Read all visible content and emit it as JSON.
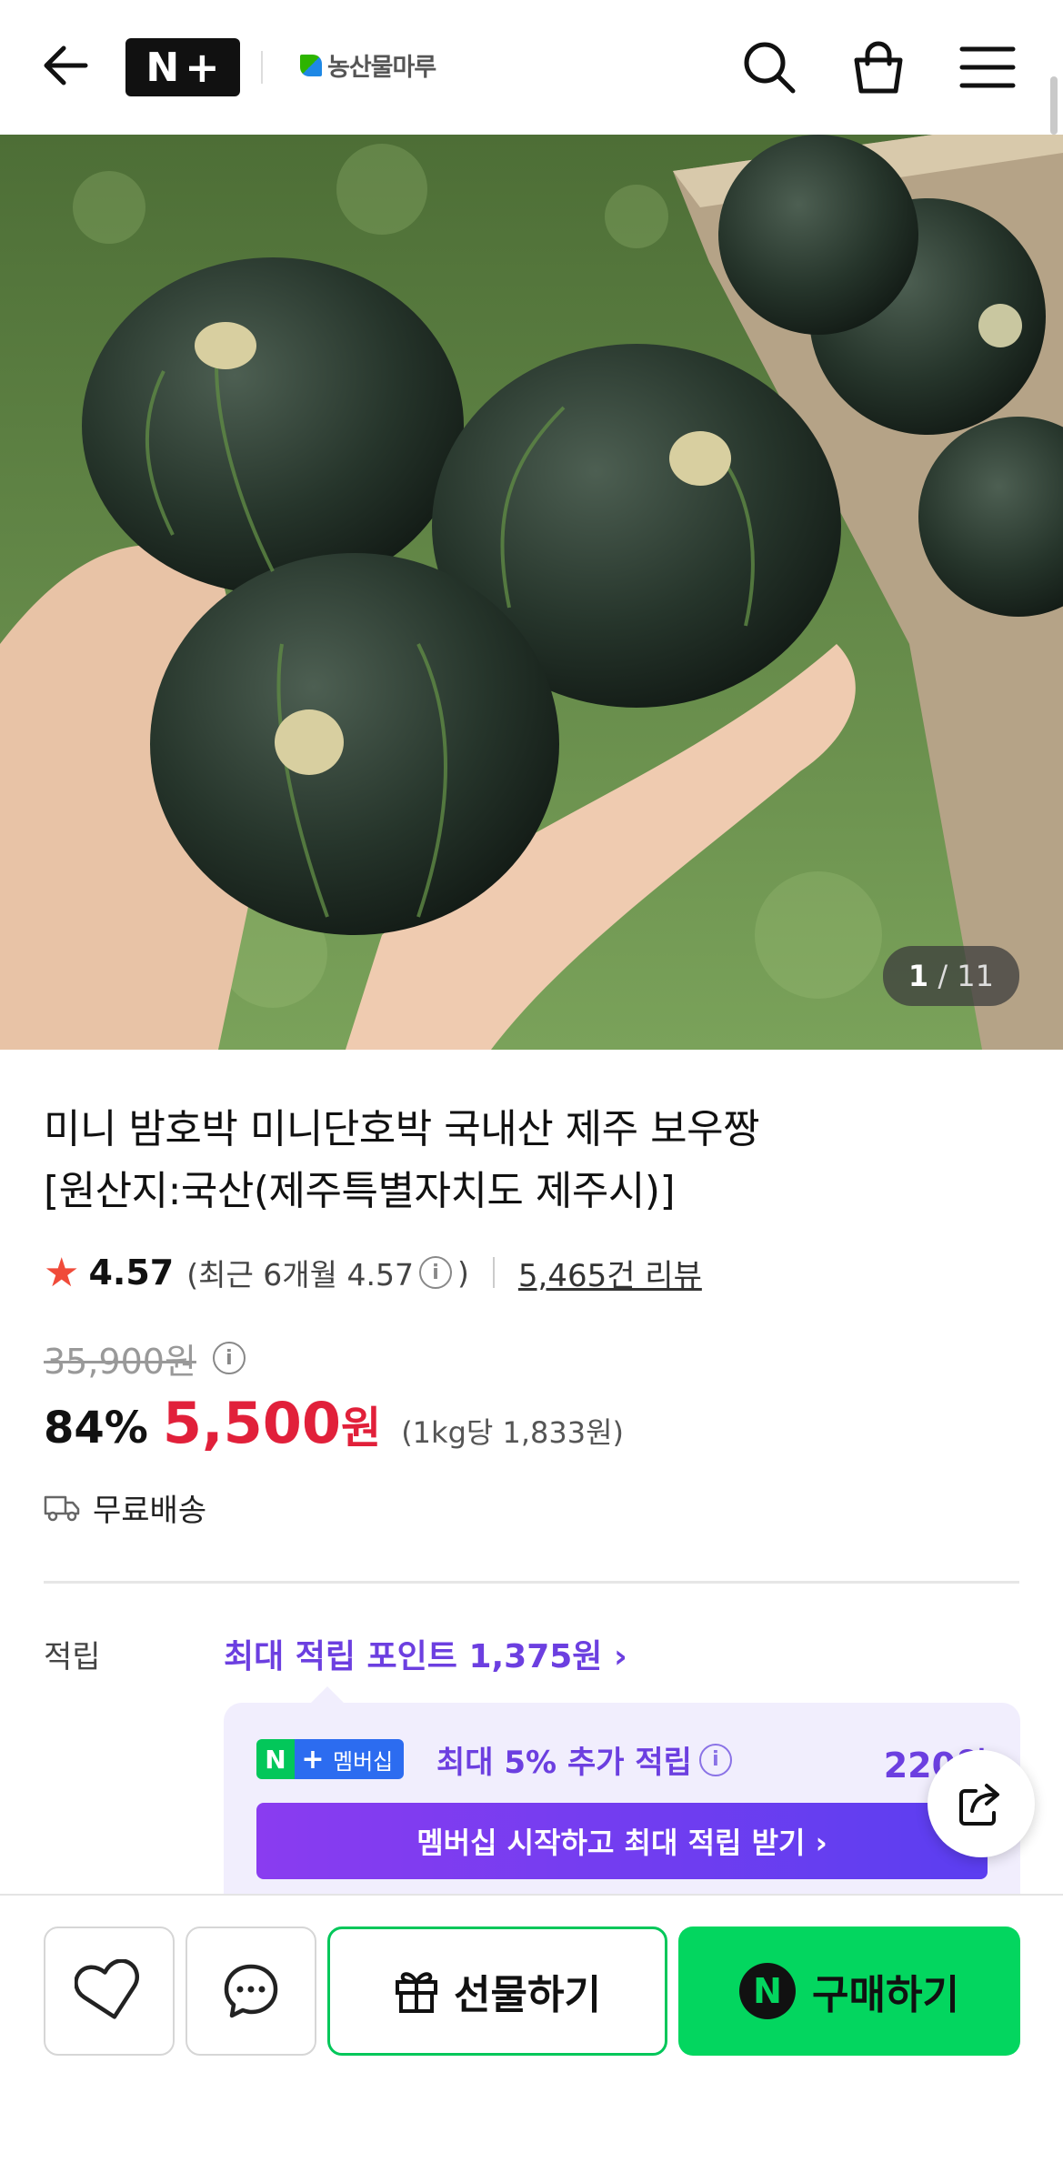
{
  "header": {
    "nplus_logo_n": "N",
    "nplus_logo_plus": "+",
    "store_name": "농산물마루",
    "icons": [
      "back-arrow-icon",
      "search-icon",
      "shopping-bag-icon",
      "menu-icon"
    ]
  },
  "gallery": {
    "current": "1",
    "separator": "/",
    "total": "11"
  },
  "product": {
    "title_line1": "미니 밤호박 미니단호박 국내산 제주 보우짱",
    "title_line2": "[원산지:국산(제주특별자치도 제주시)]",
    "rating": "4.57",
    "rating_sub_prefix": "(최근 6개월 4.57",
    "rating_sub_suffix": ")",
    "info_glyph": "i",
    "review_count_text": "5,465건 리뷰",
    "original_price": "35,900원",
    "discount": "84%",
    "sale_price": "5,500",
    "sale_price_unit": "원",
    "unit_price": "(1kg당 1,833원)",
    "shipping": "무료배송"
  },
  "points": {
    "label": "적립",
    "link_text": "최대 적립 포인트 1,375원 ›",
    "membership_badge_n": "N",
    "membership_badge_plus": "+",
    "membership_badge_text": "멤버십",
    "membership_text": "최대 5% 추가 적립",
    "membership_amount": "220원",
    "membership_cta": "멤버십 시작하고 최대 적립 받기 ›"
  },
  "bottom_bar": {
    "gift_label": "선물하기",
    "buy_badge": "N",
    "buy_label": "구매하기"
  },
  "colors": {
    "sale_red": "#e1203a",
    "naver_green": "#03c75a",
    "membership_purple": "#6c3fe0",
    "star_red": "#f04b3a"
  }
}
